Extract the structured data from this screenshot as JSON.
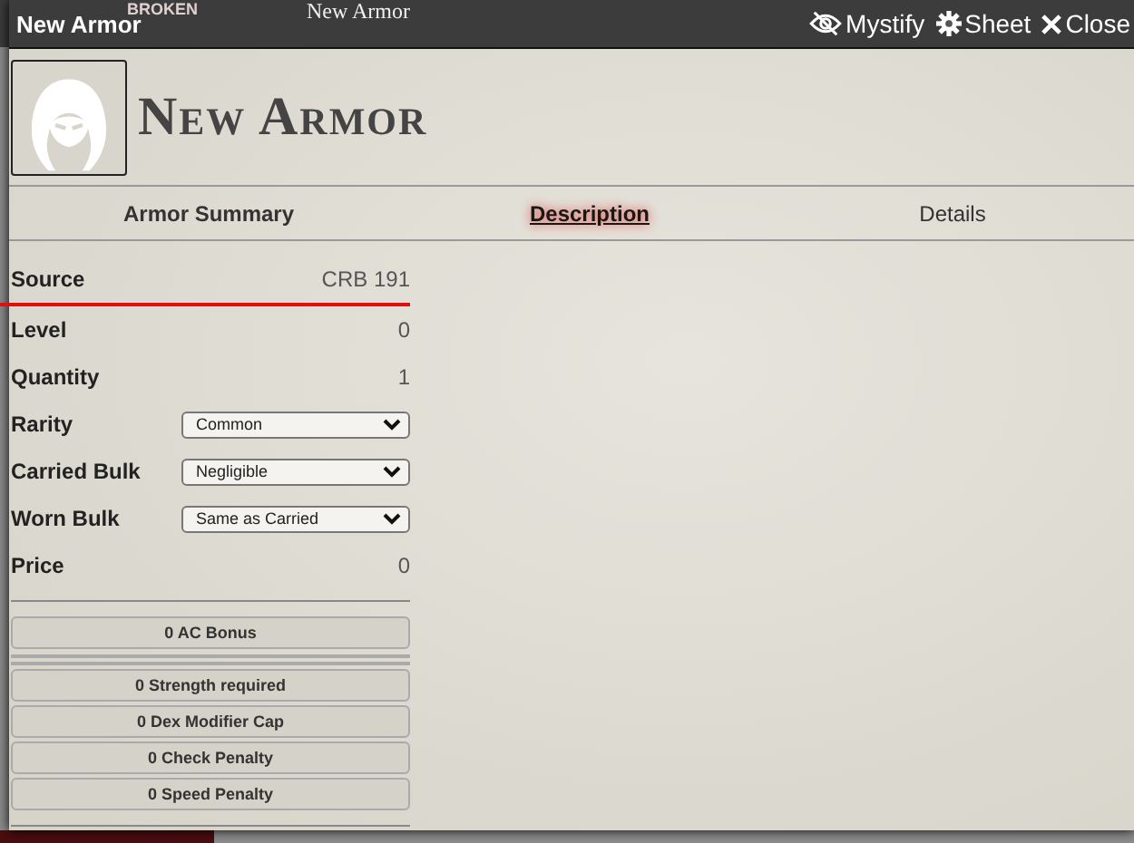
{
  "background": {
    "texts": [
      "BROKEN",
      "New Armor"
    ]
  },
  "window": {
    "title": "New Armor",
    "controls": [
      {
        "kind": "mystify",
        "label": "Mystify"
      },
      {
        "kind": "sheet",
        "label": "Sheet"
      },
      {
        "kind": "close",
        "label": "Close"
      }
    ]
  },
  "header": {
    "name": "New Armor"
  },
  "tabs": [
    {
      "label": "Armor Summary",
      "selected": false
    },
    {
      "label": "Description",
      "selected": true
    },
    {
      "label": "Details",
      "selected": false
    }
  ],
  "fields": [
    {
      "kind": "value",
      "label": "Source",
      "value": "CRB 191"
    },
    {
      "kind": "value",
      "label": "Level",
      "value": "0"
    },
    {
      "kind": "value",
      "label": "Quantity",
      "value": "1"
    },
    {
      "kind": "select",
      "label": "Rarity",
      "value": "Common"
    },
    {
      "kind": "select",
      "label": "Carried Bulk",
      "value": "Negligible"
    },
    {
      "kind": "select",
      "label": "Worn Bulk",
      "value": "Same as Carried"
    },
    {
      "kind": "value",
      "label": "Price",
      "value": "0"
    }
  ],
  "stat_groups": [
    [
      "0 AC Bonus"
    ],
    [
      "0 Strength required",
      "0 Dex Modifier Cap",
      "0 Check Penalty",
      "0 Speed Penalty"
    ]
  ]
}
